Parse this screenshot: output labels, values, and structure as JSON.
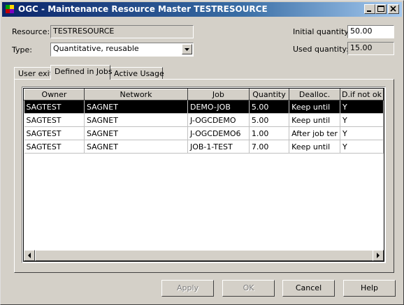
{
  "window": {
    "title": "OGC - Maintenance Resource Master TESTRESOURCE",
    "controls": [
      "minimize-icon",
      "maximize-icon",
      "close-icon"
    ],
    "titlebar_color": "#0a246a"
  },
  "form": {
    "resource_label": "Resource:",
    "resource_value": "TESTRESOURCE",
    "type_label": "Type:",
    "type_value": "Quantitative, reusable",
    "initial_quantity_label": "Initial quantity:",
    "initial_quantity_value": "50.00",
    "used_quantity_label": "Used quantity:",
    "used_quantity_value": "15.00"
  },
  "tabs": [
    {
      "label": "User exit",
      "active": false
    },
    {
      "label": "Defined in Jobs",
      "active": true
    },
    {
      "label": "Active Usage",
      "active": false
    }
  ],
  "table": {
    "columns": [
      "Owner",
      "Network",
      "Job",
      "Quantity",
      "Dealloc.",
      "D.if not ok"
    ],
    "rows": [
      {
        "owner": "SAGTEST",
        "network": "SAGNET",
        "job": "DEMO-JOB",
        "quantity": "5.00",
        "dealloc": "Keep until",
        "d_if_not_ok": "Y",
        "selected": true
      },
      {
        "owner": "SAGTEST",
        "network": "SAGNET",
        "job": "J-OGCDEMO",
        "quantity": "5.00",
        "dealloc": "Keep until",
        "d_if_not_ok": "Y",
        "selected": false
      },
      {
        "owner": "SAGTEST",
        "network": "SAGNET",
        "job": "J-OGCDEMO6",
        "quantity": "1.00",
        "dealloc": "After job ter",
        "d_if_not_ok": "Y",
        "selected": false
      },
      {
        "owner": "SAGTEST",
        "network": "SAGNET",
        "job": "JOB-1-TEST",
        "quantity": "7.00",
        "dealloc": "Keep until",
        "d_if_not_ok": "Y",
        "selected": false
      }
    ]
  },
  "buttons": {
    "apply": "Apply",
    "ok": "OK",
    "cancel": "Cancel",
    "help": "Help"
  }
}
